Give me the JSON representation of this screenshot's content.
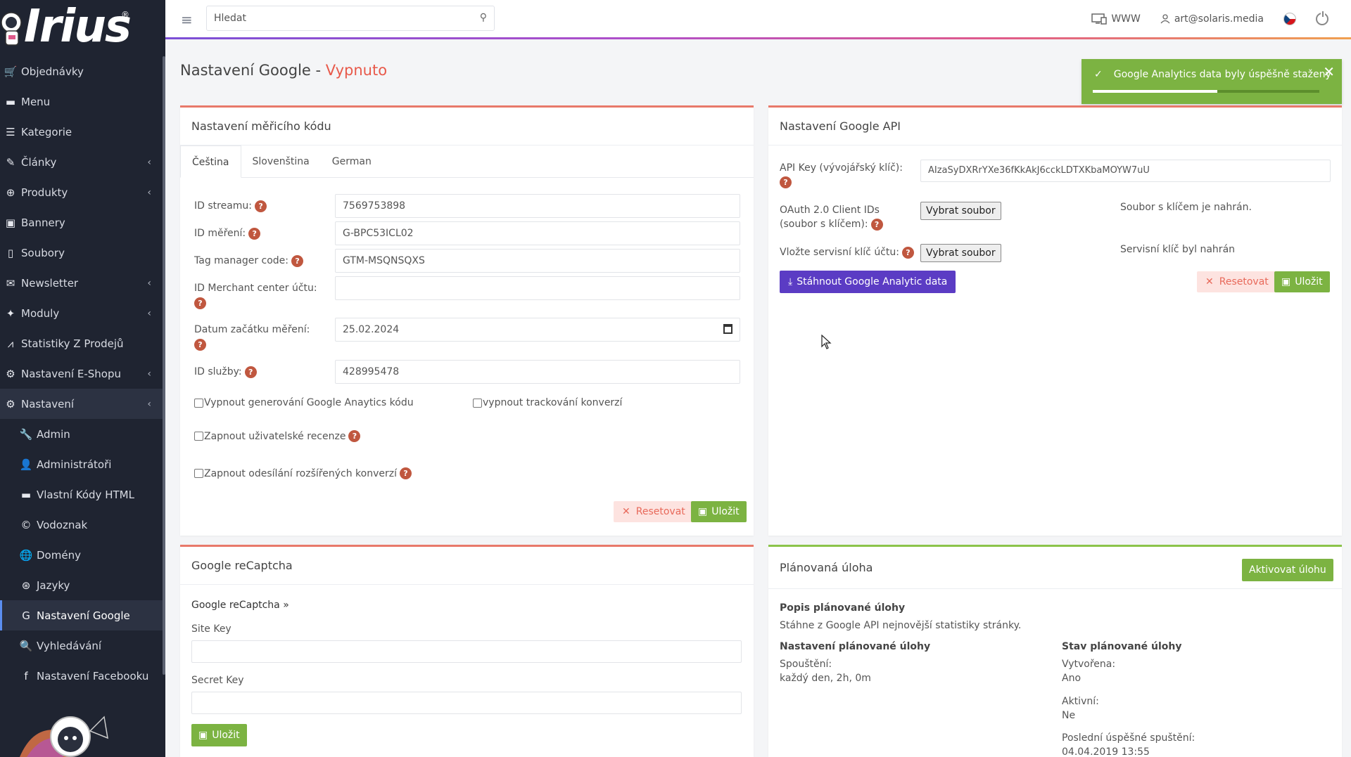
{
  "sidebar": {
    "logo_text": "Irius",
    "items": [
      {
        "label": "Objednávky",
        "icon": "cart-icon",
        "glyph": "🛒"
      },
      {
        "label": "Menu",
        "icon": "folder-icon",
        "glyph": "▬"
      },
      {
        "label": "Kategorie",
        "icon": "list-icon",
        "glyph": "☰"
      },
      {
        "label": "Články",
        "icon": "pencil-icon",
        "glyph": "✎",
        "chevron": "‹"
      },
      {
        "label": "Produkty",
        "icon": "dribbble-icon",
        "glyph": "⊕",
        "chevron": "‹"
      },
      {
        "label": "Bannery",
        "icon": "image-icon",
        "glyph": "▣"
      },
      {
        "label": "Soubory",
        "icon": "file-icon",
        "glyph": "▯"
      },
      {
        "label": "Newsletter",
        "icon": "envelope-icon",
        "glyph": "✉",
        "chevron": "‹"
      },
      {
        "label": "Moduly",
        "icon": "puzzle-icon",
        "glyph": "✦",
        "chevron": "‹"
      },
      {
        "label": "Statistiky Z Prodejů",
        "icon": "chart-icon",
        "glyph": "⩘"
      },
      {
        "label": "Nastavení E-Shopu",
        "icon": "cogs-icon",
        "glyph": "⚙",
        "chevron": "‹"
      },
      {
        "label": "Nastavení",
        "icon": "cogs-icon",
        "glyph": "⚙",
        "chevron": "‹"
      }
    ],
    "subitems": [
      {
        "label": "Admin",
        "icon": "wrench-icon",
        "glyph": "🔧"
      },
      {
        "label": "Administrátoři",
        "icon": "user-icon",
        "glyph": "👤"
      },
      {
        "label": "Vlastní Kódy HTML",
        "icon": "html-icon",
        "glyph": "▬"
      },
      {
        "label": "Vodoznak",
        "icon": "copyright-icon",
        "glyph": "©"
      },
      {
        "label": "Domény",
        "icon": "globe-icon",
        "glyph": "🌐"
      },
      {
        "label": "Jazyky",
        "icon": "language-icon",
        "glyph": "⊛"
      },
      {
        "label": "Nastavení Google",
        "icon": "google-icon",
        "glyph": "G"
      },
      {
        "label": "Vyhledávání",
        "icon": "search-icon",
        "glyph": "🔍"
      },
      {
        "label": "Nastavení Facebooku",
        "icon": "facebook-icon",
        "glyph": "f"
      }
    ]
  },
  "topbar": {
    "search_placeholder": "Hledat",
    "www_label": "WWW",
    "user_email": "art@solaris.media"
  },
  "page": {
    "title": "Nastavení Google - ",
    "state": "Vypnuto"
  },
  "toast": {
    "message": "Google Analytics data byly úspěšně staženy",
    "progress": 0.55
  },
  "measure_card": {
    "title": "Nastavení měřicího kódu",
    "tabs": [
      "Čeština",
      "Slovenština",
      "German"
    ],
    "fields": {
      "stream_id_label": "ID streamu:",
      "stream_id_value": "7569753898",
      "measure_id_label": "ID měření:",
      "measure_id_value": "G-BPC53ICL02",
      "tag_manager_label": "Tag manager code:",
      "tag_manager_value": "GTM-MSQNSQXS",
      "merchant_label": "ID Merchant center účtu:",
      "merchant_value": "",
      "start_date_label": "Datum začátku měření:",
      "start_date_value": "25.02.2024",
      "service_id_label": "ID služby:",
      "service_id_value": "428995478"
    },
    "checkboxes": {
      "disable_ga": "Vypnout generování Google Anaytics kódu",
      "disable_conv": "vypnout trackování konverzí",
      "enable_reviews": "Zapnout uživatelské recenze",
      "enable_ext_conv": "Zapnout odesílání rozšířených konverzí"
    },
    "reset_label": "Resetovat",
    "save_label": "Uložit"
  },
  "api_card": {
    "title": "Nastavení Google API",
    "api_key_label": "API Key (vývojářský klíč):",
    "api_key_value": "AIzaSyDXRrYXe36fKkAkJ6cckLDTXKbaMOYW7uU",
    "oauth_label_1": "OAuth 2.0 Client IDs",
    "oauth_label_2": "(soubor s klíčem):",
    "choose_file_label": "Vybrat soubor",
    "oauth_status": "Soubor s klíčem je nahrán.",
    "service_key_label": "Vložte servisní klíč účtu:",
    "service_key_status": "Servisní klíč byl nahrán",
    "download_label": "Stáhnout Google Analytic data",
    "reset_label": "Resetovat",
    "save_label": "Uložit"
  },
  "recaptcha_card": {
    "title": "Google reCaptcha",
    "link_label": "Google reCaptcha »",
    "site_key_label": "Site Key",
    "secret_key_label": "Secret Key",
    "save_label": "Uložit"
  },
  "task_card": {
    "title": "Plánovaná úloha",
    "activate_label": "Aktivovat úlohu",
    "desc_heading": "Popis plánované úlohy",
    "desc_text": "Stáhne z Google API nejnovější statistiky stránky.",
    "settings_heading": "Nastavení plánované úlohy",
    "run_label": "Spouštění:",
    "run_value": "každý den, 2h, 0m",
    "status_heading": "Stav plánované úlohy",
    "created_label": "Vytvořena:",
    "created_value": "Ano",
    "active_label": "Aktivní:",
    "active_value": "Ne",
    "last_run_label": "Poslední úspěšné spuštění:",
    "last_run_value": "04.04.2019 13:55"
  },
  "colors": {
    "sidebar_bg": "#1f2431",
    "accent_red": "#e8594a",
    "success_green": "#7cb342",
    "purple": "#5b3cc4"
  }
}
